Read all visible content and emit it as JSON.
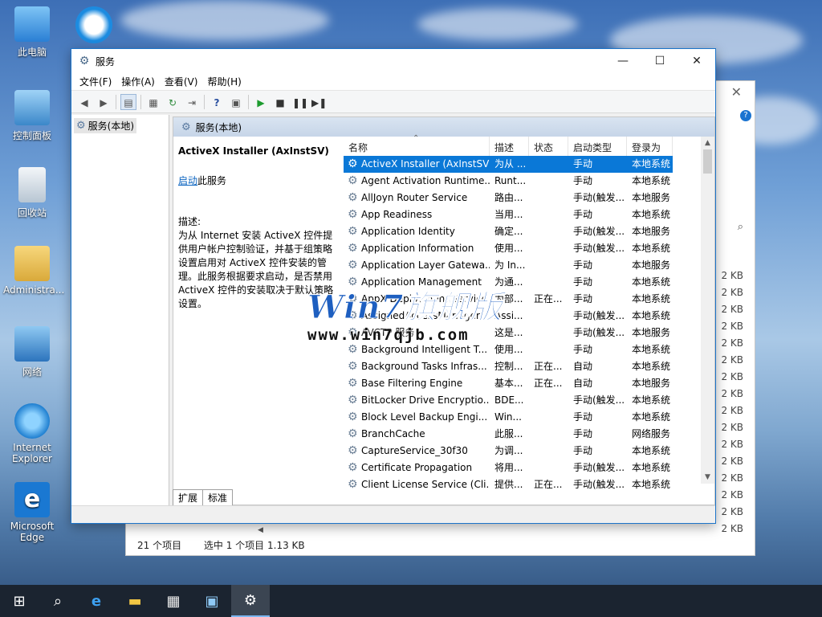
{
  "desktop": {
    "icons": [
      {
        "label": "此电脑"
      },
      {
        "label": "控制面板"
      },
      {
        "label": "回收站"
      },
      {
        "label": "Administra..."
      },
      {
        "label": "网络"
      },
      {
        "label": "Internet Explorer"
      },
      {
        "label": "Microsoft Edge"
      }
    ]
  },
  "bg_window": {
    "status_items": "21 个项目",
    "status_selected": "选中 1 个项目  1.13 KB",
    "sizes": [
      "2 KB",
      "2 KB",
      "2 KB",
      "2 KB",
      "2 KB",
      "2 KB",
      "2 KB",
      "2 KB",
      "2 KB",
      "2 KB",
      "2 KB",
      "2 KB",
      "2 KB",
      "2 KB",
      "2 KB",
      "2 KB"
    ]
  },
  "window": {
    "title": "服务",
    "menu": [
      "文件(F)",
      "操作(A)",
      "查看(V)",
      "帮助(H)"
    ],
    "tree_node": "服务(本地)",
    "content_header": "服务(本地)",
    "description": {
      "service_name": "ActiveX Installer (AxInstSV)",
      "start_link": "启动",
      "start_suffix": "此服务",
      "label": "描述:",
      "text": "为从 Internet 安装 ActiveX 控件提供用户帐户控制验证，并基于组策略设置启用对 ActiveX 控件安装的管理。此服务根据要求启动，是否禁用 ActiveX 控件的安装取决于默认策略设置。"
    },
    "columns": [
      "名称",
      "描述",
      "状态",
      "启动类型",
      "登录为"
    ],
    "services": [
      {
        "name": "ActiveX Installer (AxInstSV)",
        "desc": "为从 ...",
        "status": "",
        "startup": "手动",
        "logon": "本地系统"
      },
      {
        "name": "Agent Activation Runtime...",
        "desc": "Runt...",
        "status": "",
        "startup": "手动",
        "logon": "本地系统"
      },
      {
        "name": "AllJoyn Router Service",
        "desc": "路由...",
        "status": "",
        "startup": "手动(触发...",
        "logon": "本地服务"
      },
      {
        "name": "App Readiness",
        "desc": "当用...",
        "status": "",
        "startup": "手动",
        "logon": "本地系统"
      },
      {
        "name": "Application Identity",
        "desc": "确定...",
        "status": "",
        "startup": "手动(触发...",
        "logon": "本地服务"
      },
      {
        "name": "Application Information",
        "desc": "使用...",
        "status": "",
        "startup": "手动(触发...",
        "logon": "本地系统"
      },
      {
        "name": "Application Layer Gatewa...",
        "desc": "为 In...",
        "status": "",
        "startup": "手动",
        "logon": "本地服务"
      },
      {
        "name": "Application Management",
        "desc": "为通...",
        "status": "",
        "startup": "手动",
        "logon": "本地系统"
      },
      {
        "name": "AppX Deployment Service...",
        "desc": "为部...",
        "status": "正在...",
        "startup": "手动",
        "logon": "本地系统"
      },
      {
        "name": "AssignedAccessManager...",
        "desc": "Assi...",
        "status": "",
        "startup": "手动(触发...",
        "logon": "本地系统"
      },
      {
        "name": "AVCTP 服务",
        "desc": "这是...",
        "status": "",
        "startup": "手动(触发...",
        "logon": "本地服务"
      },
      {
        "name": "Background Intelligent T...",
        "desc": "使用...",
        "status": "",
        "startup": "手动",
        "logon": "本地系统"
      },
      {
        "name": "Background Tasks Infras...",
        "desc": "控制...",
        "status": "正在...",
        "startup": "自动",
        "logon": "本地系统"
      },
      {
        "name": "Base Filtering Engine",
        "desc": "基本...",
        "status": "正在...",
        "startup": "自动",
        "logon": "本地服务"
      },
      {
        "name": "BitLocker Drive Encryptio...",
        "desc": "BDE...",
        "status": "",
        "startup": "手动(触发...",
        "logon": "本地系统"
      },
      {
        "name": "Block Level Backup Engi...",
        "desc": "Win...",
        "status": "",
        "startup": "手动",
        "logon": "本地系统"
      },
      {
        "name": "BranchCache",
        "desc": "此服...",
        "status": "",
        "startup": "手动",
        "logon": "网络服务"
      },
      {
        "name": "CaptureService_30f30",
        "desc": "为调...",
        "status": "",
        "startup": "手动",
        "logon": "本地系统"
      },
      {
        "name": "Certificate Propagation",
        "desc": "将用...",
        "status": "",
        "startup": "手动(触发...",
        "logon": "本地系统"
      },
      {
        "name": "Client License Service (Cli...",
        "desc": "提供...",
        "status": "正在...",
        "startup": "手动(触发...",
        "logon": "本地系统"
      }
    ],
    "tabs": [
      "扩展",
      "标准"
    ]
  },
  "watermark": {
    "brand": "Win7旗舰版",
    "url": "www.win7qjb.com"
  },
  "colors": {
    "selection": "#0a78d7",
    "link": "#0b64c0",
    "window_border": "#1c74c9",
    "taskbar": "#1b2430"
  }
}
